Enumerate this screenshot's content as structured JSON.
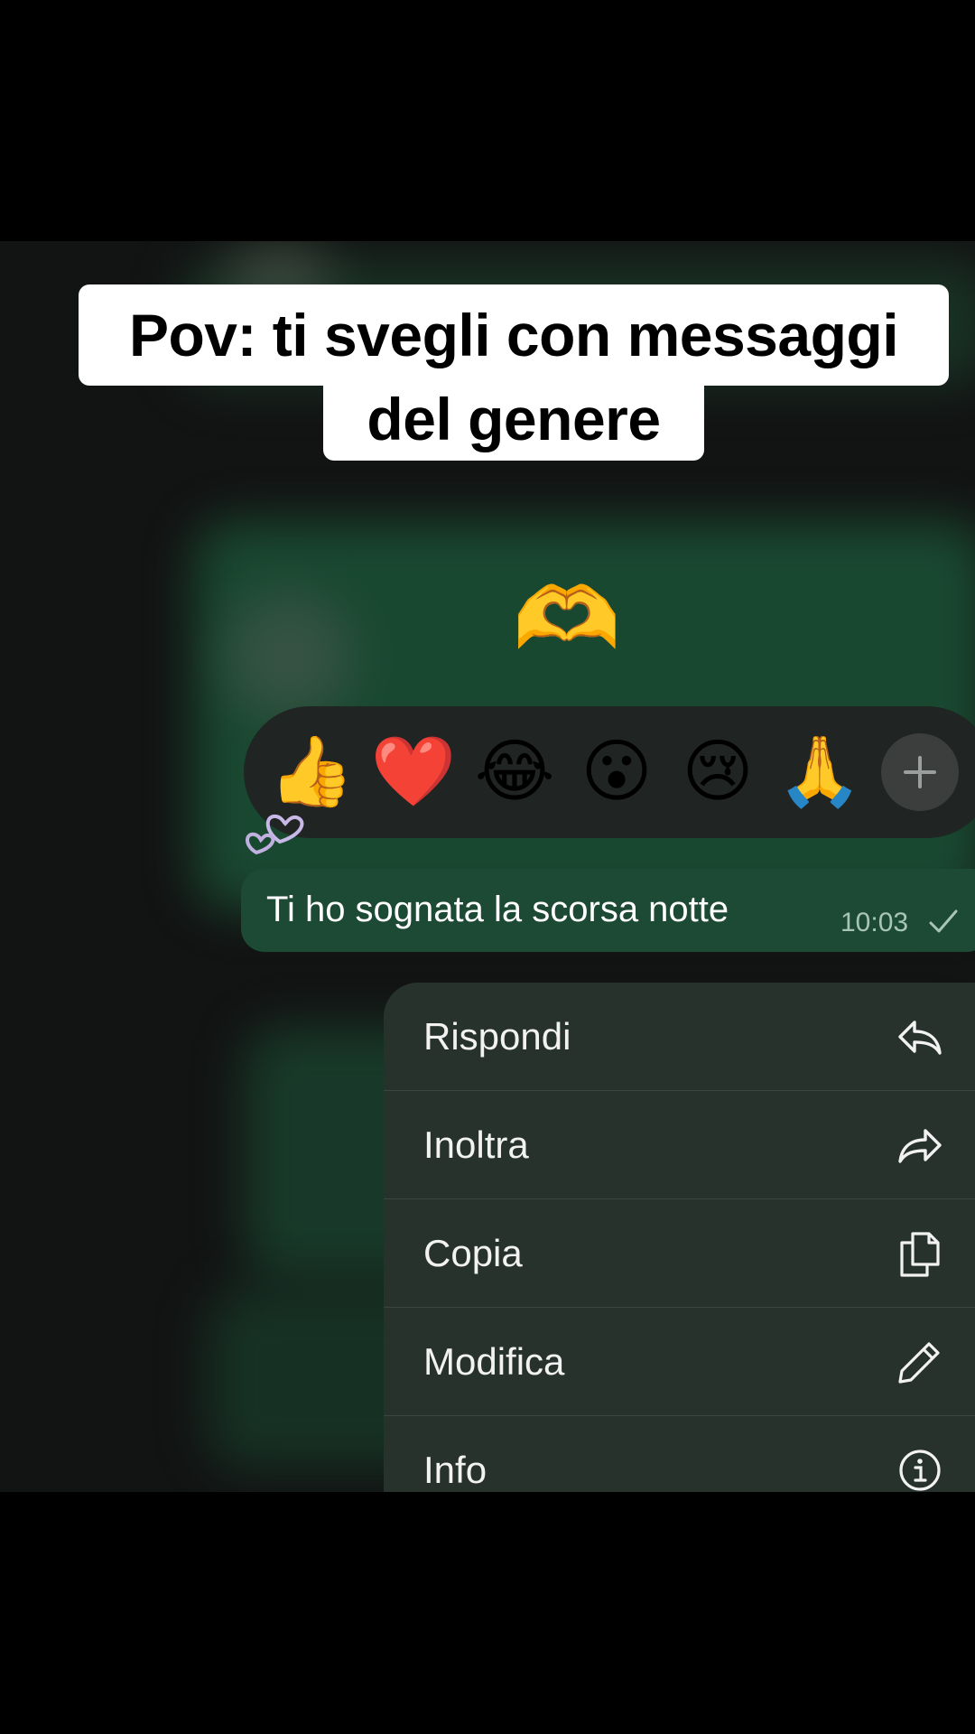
{
  "caption": {
    "line1": "Pov: ti svegli con messaggi",
    "line2": "del genere"
  },
  "emoji_message": {
    "emoji": "🫶",
    "icon": "heart-hands-emoji"
  },
  "reactions": [
    {
      "emoji": "👍",
      "name": "thumbs-up"
    },
    {
      "emoji": "❤️",
      "name": "red-heart"
    },
    {
      "emoji": "😂",
      "name": "tears-of-joy"
    },
    {
      "emoji": "😮",
      "name": "surprised"
    },
    {
      "emoji": "😢",
      "name": "crying"
    },
    {
      "emoji": "🙏",
      "name": "folded-hands"
    }
  ],
  "reaction_more_icon": "plus-icon",
  "message": {
    "text": "Ti ho sognata la scorsa notte",
    "time": "10:03",
    "status_icon": "check-icon"
  },
  "menu": [
    {
      "label": "Rispondi",
      "icon": "reply-icon"
    },
    {
      "label": "Inoltra",
      "icon": "forward-icon"
    },
    {
      "label": "Copia",
      "icon": "copy-icon"
    },
    {
      "label": "Modifica",
      "icon": "pencil-icon"
    },
    {
      "label": "Info",
      "icon": "info-icon"
    }
  ],
  "colors": {
    "bubble": "#1d4a35",
    "menu": "#27322d",
    "reaction_bar": "#202423"
  }
}
